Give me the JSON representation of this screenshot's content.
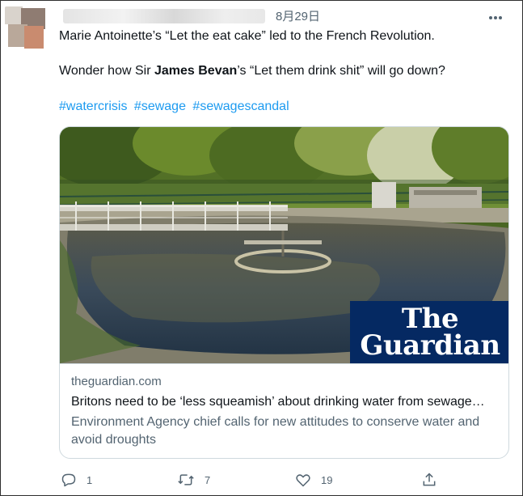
{
  "tweet": {
    "date": "8月29日",
    "line1": "Marie Antoinette’s “Let the eat cake” led to the French Revolution.",
    "line2_pre": "Wonder how Sir ",
    "line2_bold": "James Bevan",
    "line2_post": "’s “Let them drink shit” will go down?",
    "hashtags": [
      "#watercrisis",
      "#sewage",
      "#sewagescandal"
    ]
  },
  "card": {
    "logo_line1": "The",
    "logo_line2": "Guardian",
    "domain": "theguardian.com",
    "title": "Britons need to be ‘less squeamish’ about drinking water from sewage…",
    "description": "Environment Agency chief calls for new attitudes to conserve water and avoid droughts"
  },
  "actions": {
    "reply_count": "1",
    "retweet_count": "7",
    "like_count": "19"
  },
  "colors": {
    "link": "#1d9bf0",
    "secondary_text": "#536471",
    "guardian_blue": "#052962"
  },
  "icons": [
    "more-icon",
    "reply-icon",
    "retweet-icon",
    "like-icon",
    "share-icon"
  ]
}
